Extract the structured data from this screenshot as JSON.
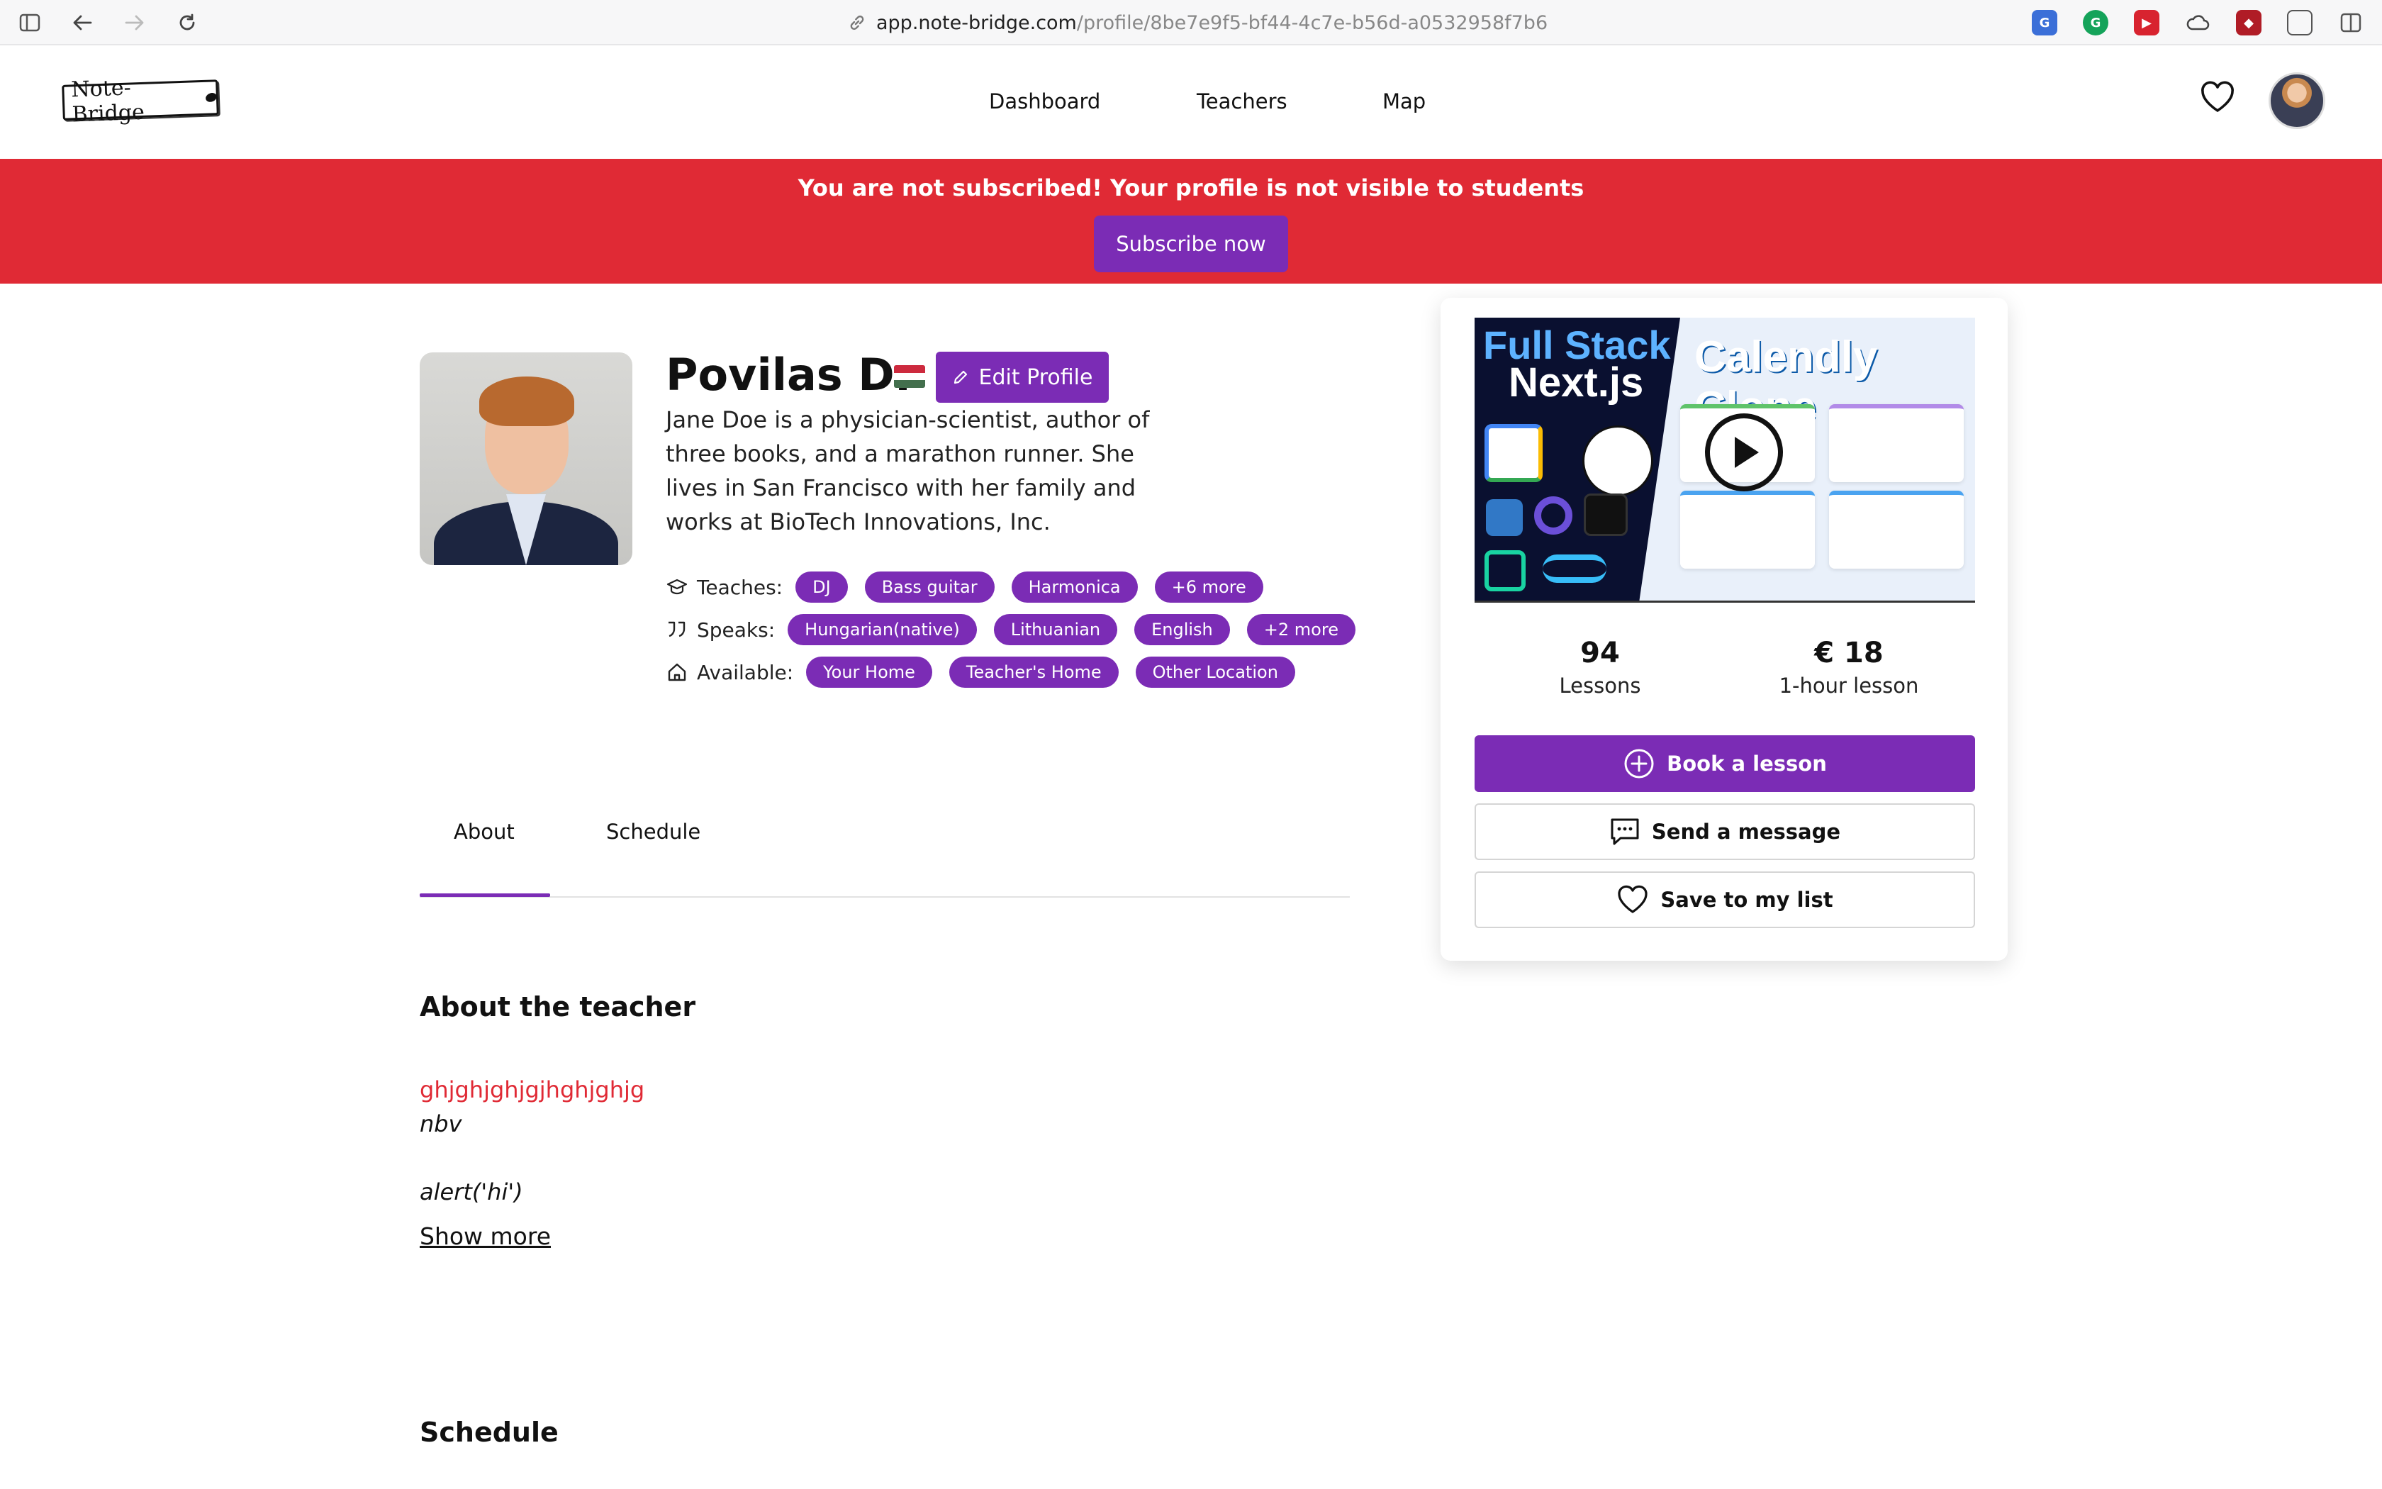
{
  "browser": {
    "url_host": "app.note-bridge.com",
    "url_path": "/profile/8be7e9f5-bf44-4c7e-b56d-a0532958f7b6"
  },
  "header": {
    "logo_text": "Note-Bridge",
    "nav": [
      "Dashboard",
      "Teachers",
      "Map"
    ]
  },
  "banner": {
    "message": "You are not subscribed! Your profile is not visible to students",
    "subscribe_label": "Subscribe now"
  },
  "profile": {
    "name": "Povilas D.",
    "edit_label": "Edit Profile",
    "bio": "Jane Doe is a physician-scientist, author of three books, and a marathon runner. She lives in San Francisco with her family and works at BioTech Innovations, Inc.",
    "teaches_label": "Teaches:",
    "teaches": [
      "DJ",
      "Bass guitar",
      "Harmonica",
      "+6 more"
    ],
    "speaks_label": "Speaks:",
    "speaks": [
      "Hungarian(native)",
      "Lithuanian",
      "English",
      "+2 more"
    ],
    "available_label": "Available:",
    "available": [
      "Your Home",
      "Teacher's Home",
      "Other Location"
    ]
  },
  "tabs": [
    "About",
    "Schedule"
  ],
  "about": {
    "title": "About the teacher",
    "line_red": "ghjghjghjgjhghjghjg",
    "line_italic_1": "nbv",
    "line_italic_2": "alert('hi')",
    "show_more": "Show more"
  },
  "schedule_title": "Schedule",
  "card": {
    "video_title_1": "Full Stack",
    "video_title_2": "Next.js",
    "video_title_3": "Calendly Clone",
    "lessons_value": "94",
    "lessons_label": "Lessons",
    "price_value": "€ 18",
    "price_label": "1-hour lesson",
    "book_label": "Book a lesson",
    "message_label": "Send a message",
    "save_label": "Save to my list"
  },
  "colors": {
    "brand_purple": "#7b2cb5",
    "alert_red": "#e02a35"
  }
}
